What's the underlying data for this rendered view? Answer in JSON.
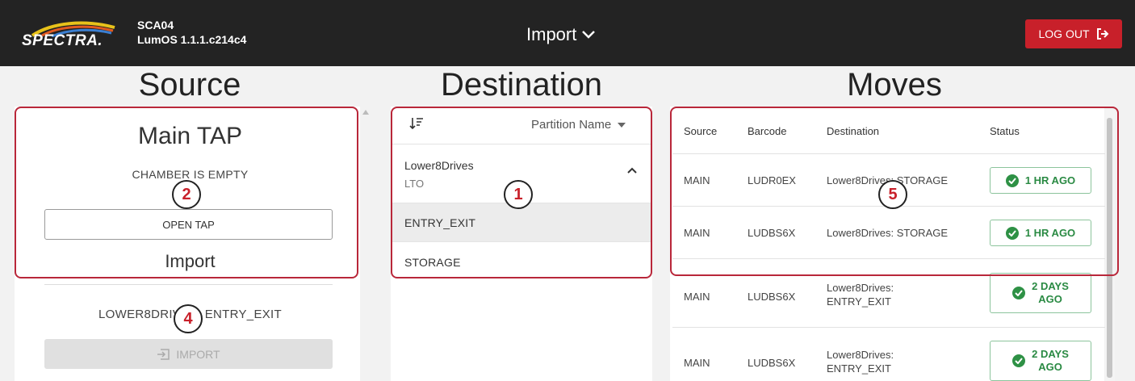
{
  "header": {
    "logo_text": "SPECTRA.",
    "system_name": "SCA04",
    "firmware": "LumOS 1.1.1.c214c4",
    "menu_title": "Import",
    "logout_label": "LOG OUT"
  },
  "columns": {
    "source": "Source",
    "destination": "Destination",
    "moves": "Moves"
  },
  "source": {
    "tap_title": "Main TAP",
    "chamber_status": "CHAMBER IS EMPTY",
    "open_tap_label": "OPEN TAP",
    "import_heading": "Import",
    "selected_destination": "LOWER8DRIVES: ENTRY_EXIT",
    "import_button_label": "IMPORT"
  },
  "destination": {
    "sort_select": "Partition Name",
    "group": {
      "name": "Lower8Drives",
      "media": "LTO"
    },
    "items": [
      "ENTRY_EXIT",
      "STORAGE"
    ],
    "selected_item": "ENTRY_EXIT"
  },
  "moves": {
    "columns": [
      "Source",
      "Barcode",
      "Destination",
      "Status"
    ],
    "rows": [
      {
        "source": "MAIN",
        "barcode": "LUDR0EX",
        "destination": "Lower8Drives: STORAGE",
        "status": "1 HR AGO"
      },
      {
        "source": "MAIN",
        "barcode": "LUDBS6X",
        "destination": "Lower8Drives: STORAGE",
        "status": "1 HR AGO"
      },
      {
        "source": "MAIN",
        "barcode": "LUDBS6X",
        "destination_line1": "Lower8Drives:",
        "destination_line2": "ENTRY_EXIT",
        "status_line1": "2 DAYS",
        "status_line2": "AGO"
      },
      {
        "source": "MAIN",
        "barcode": "LUDBS6X",
        "destination_line1": "Lower8Drives:",
        "destination_line2": "ENTRY_EXIT",
        "status_line1": "2 DAYS",
        "status_line2": "AGO"
      }
    ]
  },
  "callouts": [
    "1",
    "2",
    "4",
    "5"
  ],
  "colors": {
    "header_bg": "#232323",
    "logout_bg": "#c8202a",
    "callout_border": "#b9273a",
    "status_green": "#2a8a43",
    "selected_row_bg": "#ececec"
  },
  "icons": [
    "chevron-down-icon",
    "logout-icon",
    "sort-icon",
    "caret-down-icon",
    "chevron-up-icon",
    "import-icon",
    "check-circle-icon"
  ]
}
